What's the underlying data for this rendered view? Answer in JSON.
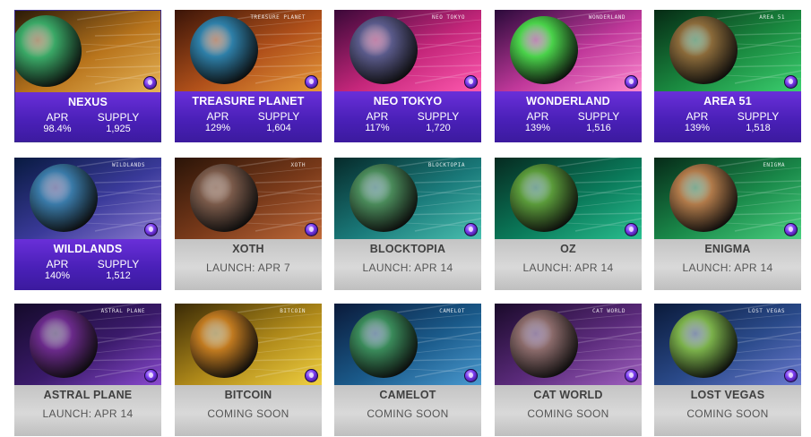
{
  "colors": {
    "panel_purple": "#4a20b8",
    "panel_gray": "#cccccc",
    "border_selected": "#3a2a8c"
  },
  "planets": [
    {
      "name": "NEXUS",
      "tag": "",
      "status": "live",
      "apr_label": "APR",
      "apr": "98.4%",
      "supply_label": "SUPPLY",
      "supply": "1,925",
      "selected": true,
      "palette": [
        "#2a1a08",
        "#b8741c",
        "#e7b558"
      ],
      "planet": "#3aa866"
    },
    {
      "name": "TREASURE PLANET",
      "tag": "TREASURE PLANET",
      "status": "live",
      "apr_label": "APR",
      "apr": "129%",
      "supply_label": "SUPPLY",
      "supply": "1,604",
      "palette": [
        "#3a1408",
        "#b0501a",
        "#e89a3a"
      ],
      "planet": "#2e7fa8"
    },
    {
      "name": "NEO TOKYO",
      "tag": "NEO TOKYO",
      "status": "live",
      "apr_label": "APR",
      "apr": "117%",
      "supply_label": "SUPPLY",
      "supply": "1,720",
      "palette": [
        "#3a0838",
        "#c4267a",
        "#ff5ab0"
      ],
      "planet": "#5a5a8a"
    },
    {
      "name": "WONDERLAND",
      "tag": "WONDERLAND",
      "status": "live",
      "apr_label": "APR",
      "apr": "139%",
      "supply_label": "SUPPLY",
      "supply": "1,516",
      "palette": [
        "#2a0a3a",
        "#c0389a",
        "#ff8ad0"
      ],
      "planet": "#4ad24a"
    },
    {
      "name": "AREA 51",
      "tag": "AREA 51",
      "status": "live",
      "apr_label": "APR",
      "apr": "139%",
      "supply_label": "SUPPLY",
      "supply": "1,518",
      "palette": [
        "#062a14",
        "#1a8a40",
        "#3cd070"
      ],
      "planet": "#8a6a3a"
    },
    {
      "name": "WILDLANDS",
      "tag": "WILDLANDS",
      "status": "live",
      "apr_label": "APR",
      "apr": "140%",
      "supply_label": "SUPPLY",
      "supply": "1,512",
      "palette": [
        "#081a40",
        "#3a3a9a",
        "#8a7ad0"
      ],
      "planet": "#3a7aa8"
    },
    {
      "name": "XOTH",
      "tag": "XOTH",
      "status": "launch",
      "launch": "LAUNCH: APR 7",
      "palette": [
        "#2a1408",
        "#7a3a1a",
        "#c06a3a"
      ],
      "planet": "#7a5a4a"
    },
    {
      "name": "BLOCKTOPIA",
      "tag": "BLOCKTOPIA",
      "status": "launch",
      "launch": "LAUNCH: APR 14",
      "palette": [
        "#062a2a",
        "#1a7a7a",
        "#4ac0b0"
      ],
      "planet": "#4a8a5a"
    },
    {
      "name": "OZ",
      "tag": "",
      "status": "launch",
      "launch": "LAUNCH: APR 14",
      "palette": [
        "#062a20",
        "#0a7a5a",
        "#2ac090"
      ],
      "planet": "#5a9a3a"
    },
    {
      "name": "ENIGMA",
      "tag": "ENIGMA",
      "status": "launch",
      "launch": "LAUNCH: APR 14",
      "palette": [
        "#062a18",
        "#1a8a4a",
        "#4ad080"
      ],
      "planet": "#b07a4a"
    },
    {
      "name": "ASTRAL PLANE",
      "tag": "ASTRAL PLANE",
      "status": "launch",
      "launch": "LAUNCH: APR 14",
      "palette": [
        "#140a2a",
        "#3a1a6a",
        "#8a4ad0"
      ],
      "planet": "#6a2a8a"
    },
    {
      "name": "BITCOIN",
      "tag": "BITCOIN",
      "status": "soon",
      "launch": "COMING SOON",
      "palette": [
        "#3a2a06",
        "#b08a1a",
        "#f0d040"
      ],
      "planet": "#c07a20"
    },
    {
      "name": "CAMELOT",
      "tag": "CAMELOT",
      "status": "soon",
      "launch": "COMING SOON",
      "palette": [
        "#0a1a3a",
        "#1a5a8a",
        "#4a9ad0"
      ],
      "planet": "#3a8a5a"
    },
    {
      "name": "CAT WORLD",
      "tag": "CAT WORLD",
      "status": "soon",
      "launch": "COMING SOON",
      "palette": [
        "#1a0a2a",
        "#5a2a7a",
        "#a060c0"
      ],
      "planet": "#8a6a6a"
    },
    {
      "name": "LOST VEGAS",
      "tag": "LOST VEGAS",
      "status": "soon",
      "launch": "COMING SOON",
      "palette": [
        "#0a1a3a",
        "#2a4a8a",
        "#6a7ad0"
      ],
      "planet": "#7ab04a"
    }
  ]
}
